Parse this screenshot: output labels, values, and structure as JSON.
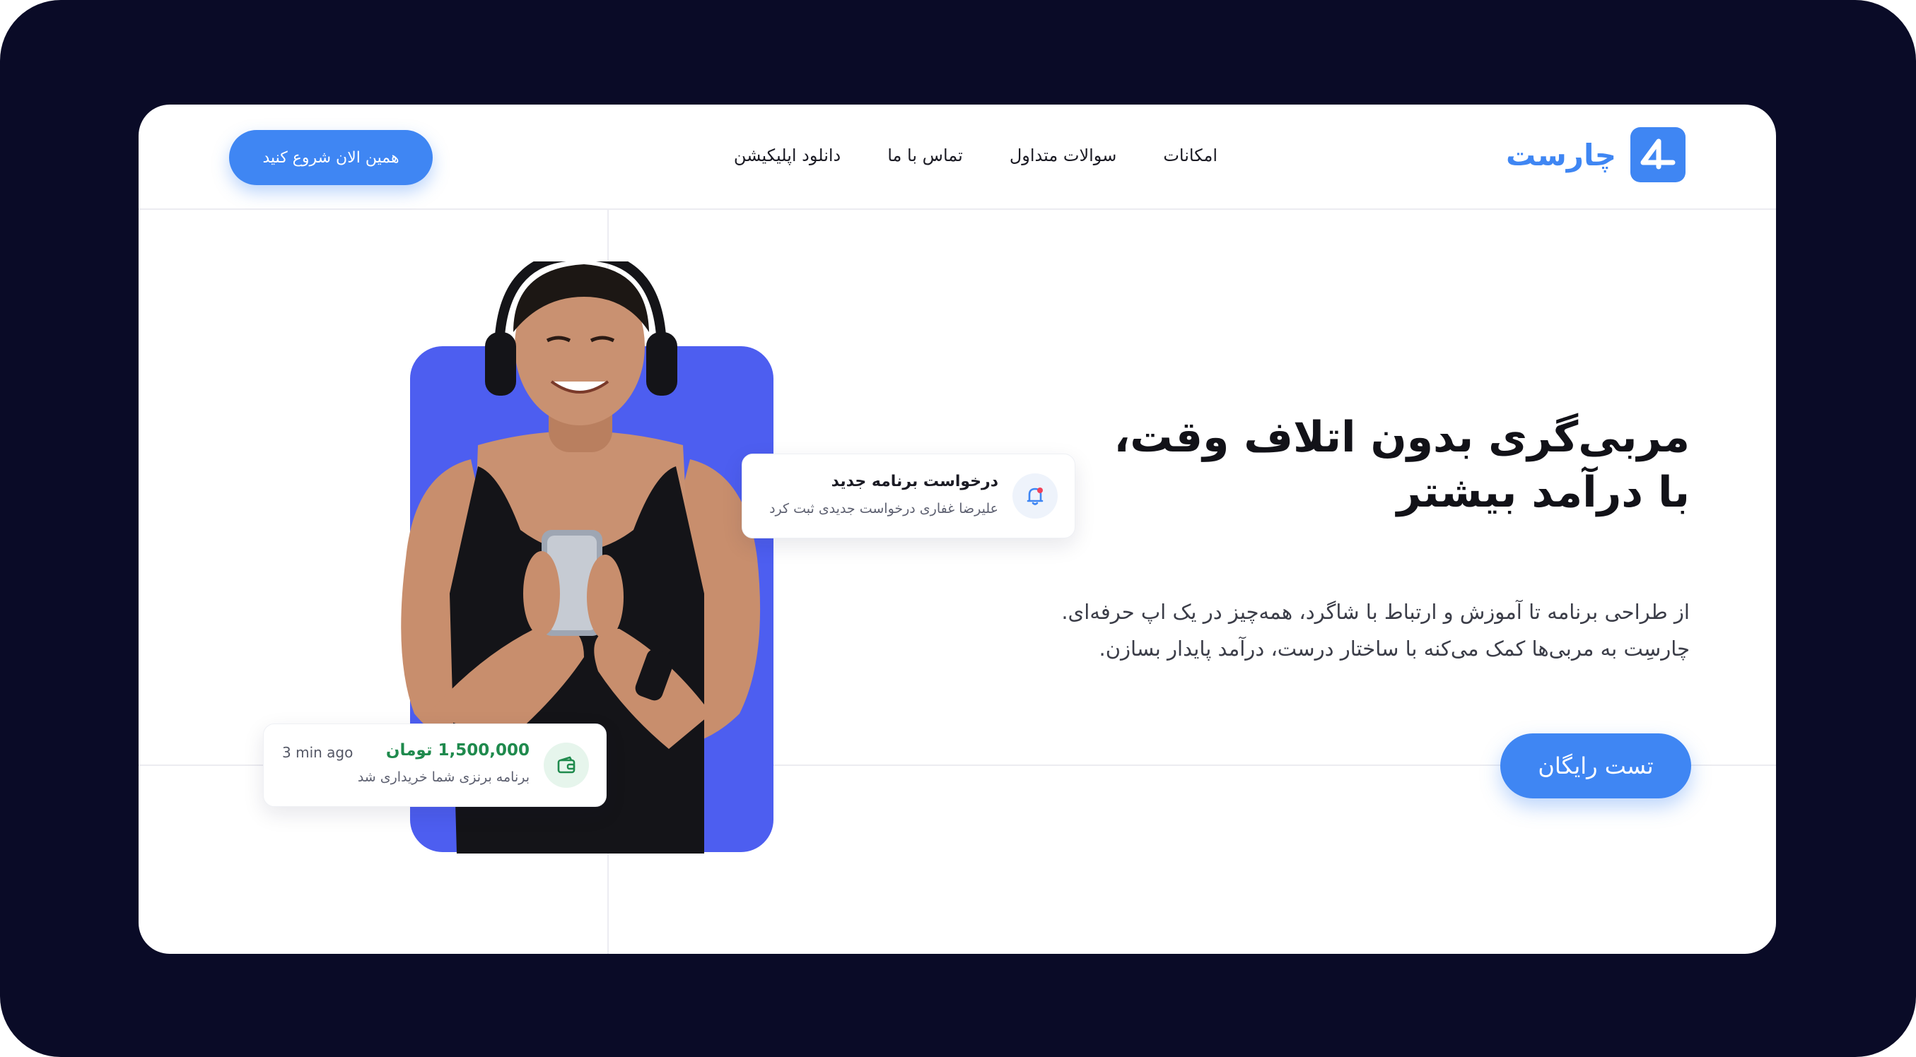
{
  "brand": {
    "name": "چارست",
    "accent": "#3f86f3"
  },
  "nav": {
    "items": [
      "امکانات",
      "سوالات متداول",
      "تماس با ما",
      "دانلود اپلیکیشن"
    ],
    "cta_label": "همین الان شروع کنید"
  },
  "hero": {
    "title_line1": "مربی‌گری بدون اتلاف وقت،",
    "title_line2": "با درآمد بیشتر",
    "desc_line1": "از طراحی برنامه تا آموزش و ارتباط با شاگرد، همه‌چیز در یک اپ حرفه‌ای.",
    "desc_line2": "چارسِت به مربی‌ها کمک می‌کنه با ساختار درست، درآمد پایدار بسازن.",
    "cta_label": "تست رایگان"
  },
  "notification": {
    "title": "درخواست برنامه جدید",
    "subtitle": "علیرضا غفاری درخواست جدیدی ثبت کرد",
    "icon": "bell-icon"
  },
  "payment": {
    "amount": "1,500,000 تومان",
    "subtitle": "برنامه برنزی شما خریداری شد",
    "time": "3 min ago",
    "icon": "wallet-icon"
  },
  "colors": {
    "background": "#0a0b27",
    "photo_bg": "#4d5ef0",
    "success": "#1f8a4d"
  }
}
